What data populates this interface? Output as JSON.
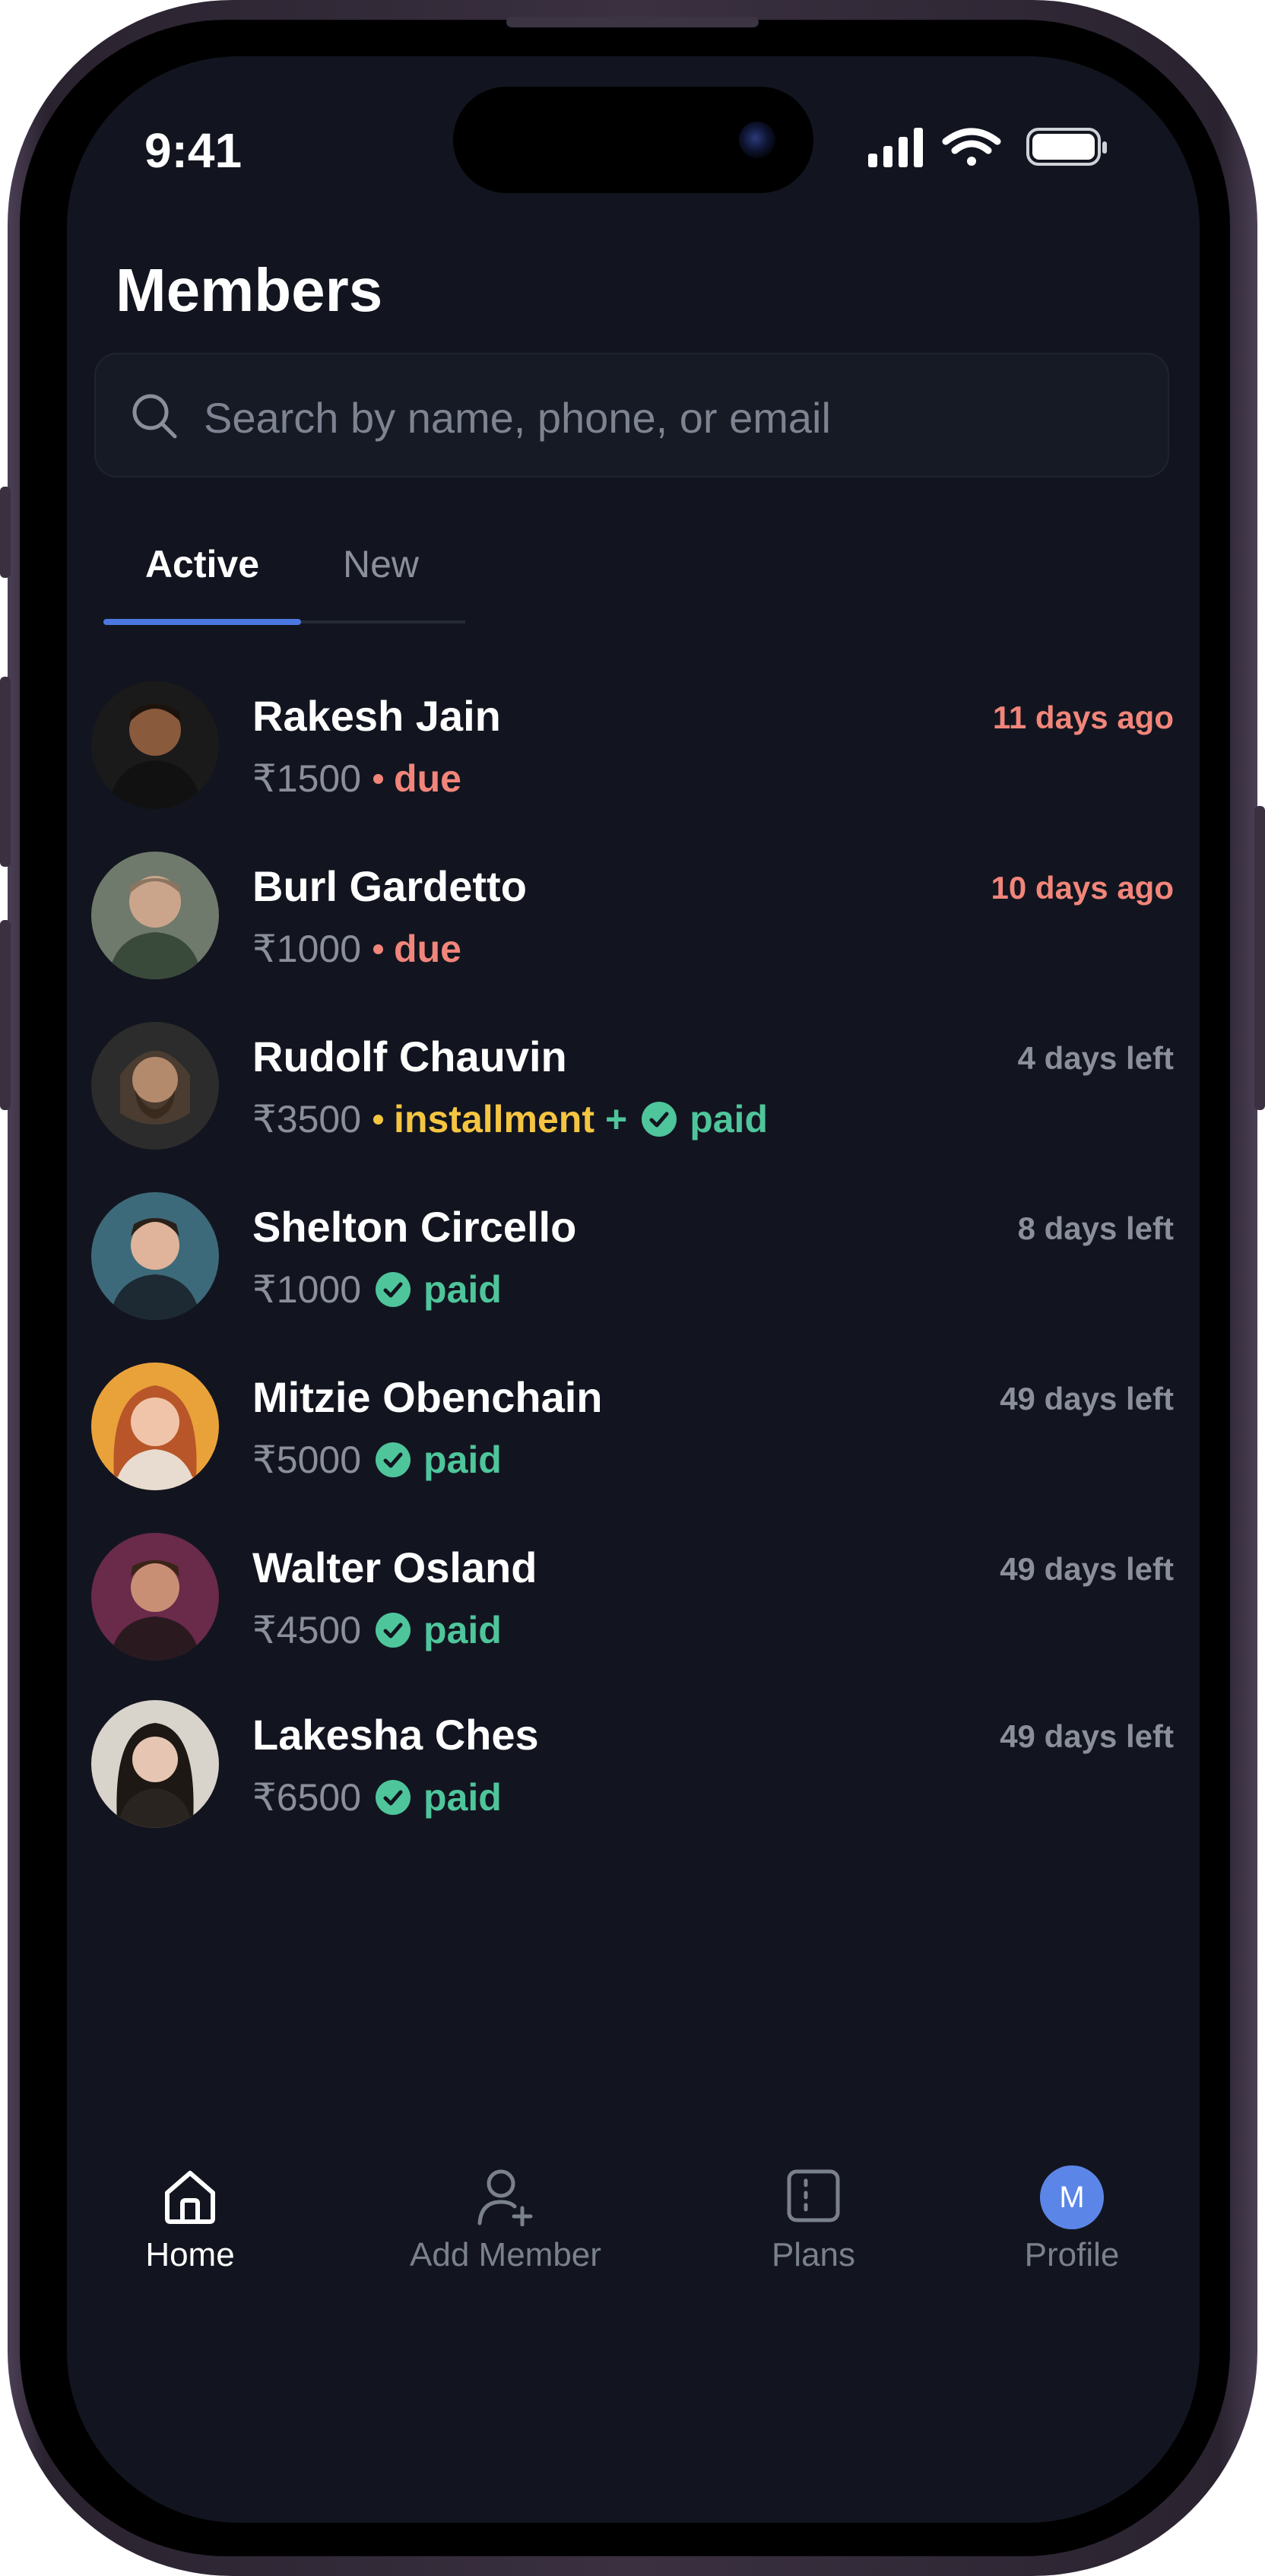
{
  "status_bar": {
    "time": "9:41"
  },
  "header": {
    "title": "Members",
    "search_placeholder": "Search by name, phone, or email"
  },
  "tabs": [
    {
      "label": "Active",
      "selected": true
    },
    {
      "label": "New",
      "selected": false
    }
  ],
  "members": [
    {
      "name": "Rakesh Jain",
      "amount": "₹1500",
      "status": "due",
      "status_label": "due",
      "right_text": "11 days ago",
      "right_style": "overdue"
    },
    {
      "name": "Burl Gardetto",
      "amount": "₹1000",
      "status": "due",
      "status_label": "due",
      "right_text": "10 days ago",
      "right_style": "overdue"
    },
    {
      "name": "Rudolf Chauvin",
      "amount": "₹3500",
      "status": "installment",
      "status_label": "installment",
      "plus": "+",
      "paid_label": "paid",
      "right_text": "4 days left",
      "right_style": "left"
    },
    {
      "name": "Shelton Circello",
      "amount": "₹1000",
      "status": "paid",
      "status_label": "paid",
      "right_text": "8 days left",
      "right_style": "left"
    },
    {
      "name": "Mitzie Obenchain",
      "amount": "₹5000",
      "status": "paid",
      "status_label": "paid",
      "right_text": "49 days left",
      "right_style": "left"
    },
    {
      "name": "Walter Osland",
      "amount": "₹4500",
      "status": "paid",
      "status_label": "paid",
      "right_text": "49 days left",
      "right_style": "left"
    },
    {
      "name": "Lakesha Ches",
      "amount": "₹6500",
      "status": "paid",
      "status_label": "paid",
      "right_text": "49 days left",
      "right_style": "left"
    }
  ],
  "bottom_nav": {
    "home": {
      "label": "Home",
      "icon": "home-icon",
      "selected": true
    },
    "add_member": {
      "label": "Add Member",
      "icon": "add-user-icon"
    },
    "plans": {
      "label": "Plans",
      "icon": "plans-icon"
    },
    "profile": {
      "label": "Profile",
      "initial": "M"
    }
  },
  "colors": {
    "background": "#12151f",
    "accent": "#4b78e0",
    "due": "#f2857a",
    "installment": "#f5c542",
    "paid": "#4fc59b",
    "muted": "#8a8f9b",
    "profile_badge": "#5b86e8"
  }
}
